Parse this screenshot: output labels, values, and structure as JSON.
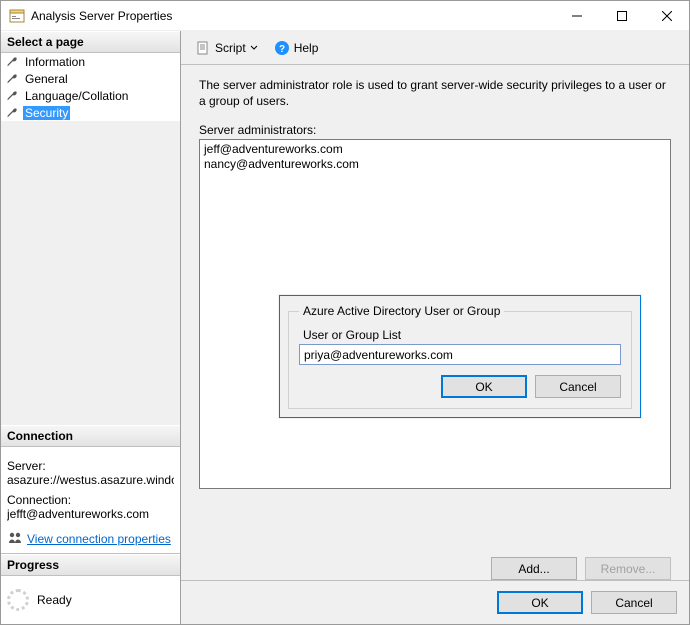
{
  "window": {
    "title": "Analysis Server Properties",
    "icon": "properties-icon"
  },
  "sidebar": {
    "select_page_header": "Select a page",
    "pages": [
      {
        "label": "Information",
        "selected": false
      },
      {
        "label": "General",
        "selected": false
      },
      {
        "label": "Language/Collation",
        "selected": false
      },
      {
        "label": "Security",
        "selected": true
      }
    ],
    "connection_header": "Connection",
    "server_label": "Server:",
    "server_value": "asazure://westus.asazure.windows",
    "connection_label": "Connection:",
    "connection_value": "jefft@adventureworks.com",
    "view_conn_props": "View connection properties",
    "progress_header": "Progress",
    "progress_status": "Ready"
  },
  "toolbar": {
    "script_label": "Script",
    "help_label": "Help"
  },
  "main": {
    "description": "The server administrator role is used to grant server-wide security privileges to a user or a group of users.",
    "admins_label": "Server administrators:",
    "admins": [
      "jeff@adventureworks.com",
      "nancy@adventureworks.com"
    ],
    "add_label": "Add...",
    "remove_label": "Remove..."
  },
  "modal": {
    "group_title": "Azure Active Directory User or Group",
    "field_label": "User or Group List",
    "value": "priya@adventureworks.com",
    "ok_label": "OK",
    "cancel_label": "Cancel"
  },
  "footer": {
    "ok_label": "OK",
    "cancel_label": "Cancel"
  }
}
